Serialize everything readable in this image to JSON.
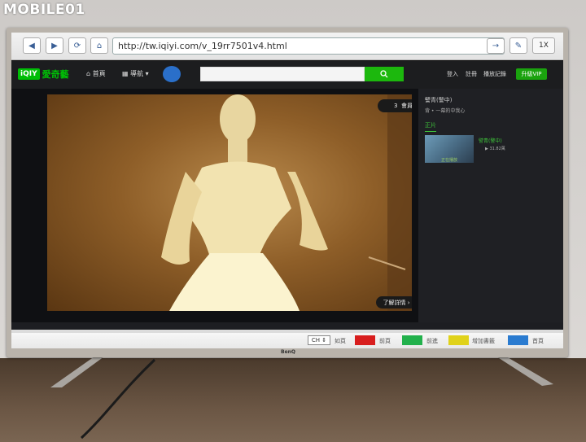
{
  "watermark": "MOBILE01",
  "tv": {
    "brand": "BenQ"
  },
  "browser": {
    "url": "http://tw.iqiyi.com/v_19rr7501v4.html",
    "zoom": "1X",
    "icons": [
      "back-arrow-icon",
      "forward-arrow-icon",
      "refresh-icon",
      "home-icon",
      "go-arrow-icon",
      "bookmark-icon"
    ]
  },
  "site": {
    "logo_badge": "iQIY",
    "logo_name": "愛奇藝",
    "nav_home": "首頁",
    "nav_guide": "導航",
    "search_value": "",
    "search_icon": "search-icon",
    "login": "登入",
    "register": "註冊",
    "history": "播放記錄",
    "vip": "升級VIP"
  },
  "player": {
    "ad_badge": "會員免廣告",
    "ad_prefix": "3",
    "detail": "了解詳情"
  },
  "sidebar": {
    "title": "譬青(警中)",
    "subtitle": "背 • 一幕的中我心",
    "tab": "正片",
    "episode": "譬青(警中)",
    "plays": "31.82萬",
    "thumb_caption": "正在播放"
  },
  "remote": {
    "ch": "CH",
    "labels": [
      "如頁",
      "前頁",
      "前進",
      "增加書籤",
      "首頁"
    ],
    "colors": [
      "#d81e1e",
      "#22b14c",
      "#e0d21a",
      "#2a7bd0"
    ]
  }
}
